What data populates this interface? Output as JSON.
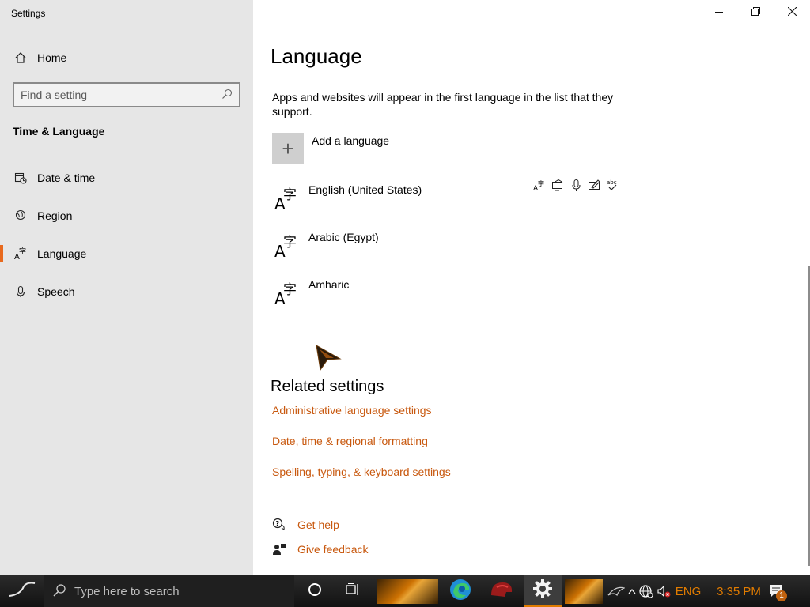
{
  "window": {
    "app_title": "Settings",
    "controls": {
      "minimize_icon": "minimize-icon",
      "restore_icon": "restore-icon",
      "close_icon": "close-icon"
    }
  },
  "sidebar": {
    "home_label": "Home",
    "search_placeholder": "Find a setting",
    "section_title": "Time & Language",
    "items": [
      {
        "label": "Date & time",
        "icon": "calendar-clock-icon"
      },
      {
        "label": "Region",
        "icon": "globe-icon"
      },
      {
        "label": "Language",
        "icon": "language-icon",
        "selected": true
      },
      {
        "label": "Speech",
        "icon": "microphone-icon"
      }
    ]
  },
  "main": {
    "title": "Language",
    "description": "Apps and websites will appear in the first language in the list that they support.",
    "add_language_label": "Add a language",
    "languages": [
      {
        "name": "English (United States)"
      },
      {
        "name": "Arabic (Egypt)"
      },
      {
        "name": "Amharic"
      }
    ],
    "feature_icons": [
      "display-language-icon",
      "text-to-speech-icon",
      "speech-recognition-icon",
      "handwriting-icon",
      "spellcheck-icon"
    ],
    "related_title": "Related settings",
    "related_links": [
      "Administrative language settings",
      "Date, time & regional formatting",
      "Spelling, typing, & keyboard settings"
    ],
    "help": {
      "get_help": "Get help",
      "give_feedback": "Give feedback"
    }
  },
  "taskbar": {
    "search_placeholder": "Type here to search",
    "tray": {
      "language": "ENG",
      "time": "3:35 PM",
      "notification_count": "1"
    }
  },
  "colors": {
    "accent": "#e8691d",
    "link": "#c8580e",
    "sidebar_bg": "#e6e6e6"
  }
}
